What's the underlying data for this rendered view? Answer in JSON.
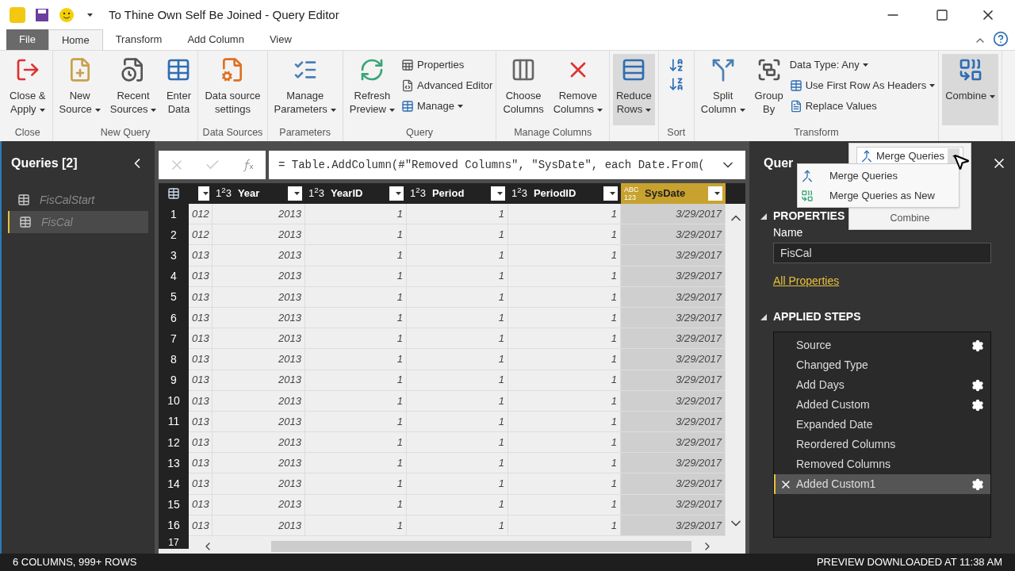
{
  "window": {
    "title": "To Thine Own Self Be Joined - Query Editor"
  },
  "tabs": [
    {
      "label": "File",
      "kind": "file",
      "selected": false
    },
    {
      "label": "Home",
      "kind": "tab",
      "selected": true
    },
    {
      "label": "Transform",
      "kind": "tab",
      "selected": false
    },
    {
      "label": "Add Column",
      "kind": "tab",
      "selected": false
    },
    {
      "label": "View",
      "kind": "tab",
      "selected": false
    }
  ],
  "ribbon": {
    "groups": [
      {
        "label": "Close",
        "kind": "buttons",
        "buttons": [
          {
            "kind": "close-apply",
            "lines": [
              "Close &",
              "Apply"
            ],
            "dropdown": true
          }
        ]
      },
      {
        "label": "New Query",
        "kind": "buttons",
        "buttons": [
          {
            "kind": "new-source",
            "lines": [
              "New",
              "Source"
            ],
            "dropdown": true
          },
          {
            "kind": "recent",
            "lines": [
              "Recent",
              "Sources"
            ],
            "dropdown": true
          },
          {
            "kind": "table",
            "lines": [
              "Enter",
              "Data"
            ],
            "dropdown": false
          }
        ]
      },
      {
        "label": "Data Sources",
        "kind": "buttons",
        "buttons": [
          {
            "kind": "doc-gear",
            "lines": [
              "Data source",
              "settings"
            ],
            "dropdown": false
          }
        ]
      },
      {
        "label": "Parameters",
        "kind": "buttons",
        "buttons": [
          {
            "kind": "params",
            "lines": [
              "Manage",
              "Parameters"
            ],
            "dropdown": true
          }
        ]
      },
      {
        "label": "Query",
        "kind": "buttons",
        "buttons": [
          {
            "kind": "refresh",
            "lines": [
              "Refresh",
              "Preview"
            ],
            "dropdown": true
          }
        ],
        "small": [
          {
            "kind": "properties",
            "label": "Properties",
            "dropdown": false
          },
          {
            "kind": "editor",
            "label": "Advanced Editor",
            "dropdown": false
          },
          {
            "kind": "table",
            "label": "Manage",
            "dropdown": true
          }
        ]
      },
      {
        "label": "Manage Columns",
        "kind": "buttons",
        "buttons": [
          {
            "kind": "choose",
            "lines": [
              "Choose",
              "Columns"
            ],
            "dropdown": false
          },
          {
            "kind": "remove",
            "lines": [
              "Remove",
              "Columns"
            ],
            "dropdown": true
          }
        ]
      },
      {
        "kind": "buttons",
        "buttons": [
          {
            "kind": "reduce",
            "lines": [
              "Reduce",
              "Rows"
            ],
            "dropdown": true,
            "highlighted": true
          }
        ]
      },
      {
        "label": "Sort",
        "kind": "sort"
      },
      {
        "label": "Transform",
        "kind": "buttons",
        "buttons": [
          {
            "kind": "split",
            "lines": [
              "Split",
              "Column"
            ],
            "dropdown": true
          },
          {
            "kind": "group",
            "lines": [
              "Group",
              "By"
            ],
            "dropdown": false
          }
        ],
        "small": [
          {
            "kind": "plain",
            "label": "Data Type: Any",
            "dropdown": true
          },
          {
            "kind": "table",
            "label": "Use First Row As Headers",
            "dropdown": true
          },
          {
            "kind": "replace",
            "label": "Replace Values",
            "dropdown": false
          }
        ]
      },
      {
        "kind": "buttons",
        "buttons": [
          {
            "kind": "combine",
            "lines": [
              "Combine"
            ],
            "dropdown": true,
            "highlighted": true
          }
        ]
      }
    ]
  },
  "combine_popup": {
    "button": "Merge Queries",
    "group_label": "Combine",
    "menu": [
      {
        "label": "Merge Queries",
        "kind": "merge"
      },
      {
        "label": "Merge Queries as New",
        "kind": "merge-new"
      }
    ]
  },
  "queries_panel": {
    "title": "Queries [2]",
    "items": [
      {
        "label": "FisCalStart",
        "selected": false
      },
      {
        "label": "FisCal",
        "selected": true
      }
    ]
  },
  "formula_bar": {
    "formula": "= Table.AddColumn(#\"Removed Columns\", \"SysDate\", each Date.From("
  },
  "table": {
    "columns": [
      {
        "selected": false
      },
      {
        "label": "Year",
        "type_label": "1$^{2}$3",
        "selected": false
      },
      {
        "label": "YearID",
        "type_label": "1$^{2}$3",
        "selected": false
      },
      {
        "label": "Period",
        "type_label": "1$^{2}$3",
        "selected": false
      },
      {
        "label": "PeriodID",
        "type_label": "1$^{2}$3",
        "selected": false
      },
      {
        "label": "SysDate",
        "type_label": "ABC 123",
        "selected": true
      }
    ],
    "rows": [
      [
        "1",
        "012",
        "2013",
        "1",
        "1",
        "1",
        "3/29/2017"
      ],
      [
        "2",
        "012",
        "2013",
        "1",
        "1",
        "1",
        "3/29/2017"
      ],
      [
        "3",
        "013",
        "2013",
        "1",
        "1",
        "1",
        "3/29/2017"
      ],
      [
        "4",
        "013",
        "2013",
        "1",
        "1",
        "1",
        "3/29/2017"
      ],
      [
        "5",
        "013",
        "2013",
        "1",
        "1",
        "1",
        "3/29/2017"
      ],
      [
        "6",
        "013",
        "2013",
        "1",
        "1",
        "1",
        "3/29/2017"
      ],
      [
        "7",
        "013",
        "2013",
        "1",
        "1",
        "1",
        "3/29/2017"
      ],
      [
        "8",
        "013",
        "2013",
        "1",
        "1",
        "1",
        "3/29/2017"
      ],
      [
        "9",
        "013",
        "2013",
        "1",
        "1",
        "1",
        "3/29/2017"
      ],
      [
        "10",
        "013",
        "2013",
        "1",
        "1",
        "1",
        "3/29/2017"
      ],
      [
        "11",
        "013",
        "2013",
        "1",
        "1",
        "1",
        "3/29/2017"
      ],
      [
        "12",
        "013",
        "2013",
        "1",
        "1",
        "1",
        "3/29/2017"
      ],
      [
        "13",
        "013",
        "2013",
        "1",
        "1",
        "1",
        "3/29/2017"
      ],
      [
        "14",
        "013",
        "2013",
        "1",
        "1",
        "1",
        "3/29/2017"
      ],
      [
        "15",
        "013",
        "2013",
        "1",
        "1",
        "1",
        "3/29/2017"
      ],
      [
        "16",
        "013",
        "2013",
        "1",
        "1",
        "1",
        "3/29/2017"
      ]
    ],
    "partial_row": "17"
  },
  "query_settings": {
    "title": "Quer",
    "properties_heading": "PROPERTIES",
    "name_label": "Name",
    "name_value": "FisCal",
    "all_properties": "All Properties",
    "steps_heading": "APPLIED STEPS",
    "steps": [
      {
        "label": "Source",
        "gear": true,
        "selected": false
      },
      {
        "label": "Changed Type",
        "gear": false,
        "selected": false
      },
      {
        "label": "Add Days",
        "gear": true,
        "selected": false
      },
      {
        "label": "Added Custom",
        "gear": true,
        "selected": false
      },
      {
        "label": "Expanded Date",
        "gear": false,
        "selected": false
      },
      {
        "label": "Reordered Columns",
        "gear": false,
        "selected": false
      },
      {
        "label": "Removed Columns",
        "gear": false,
        "selected": false
      },
      {
        "label": "Added Custom1",
        "gear": true,
        "selected": true
      }
    ]
  },
  "status_bar": {
    "left": "6 COLUMNS, 999+ ROWS",
    "right": "PREVIEW DOWNLOADED AT 11:38 AM"
  }
}
